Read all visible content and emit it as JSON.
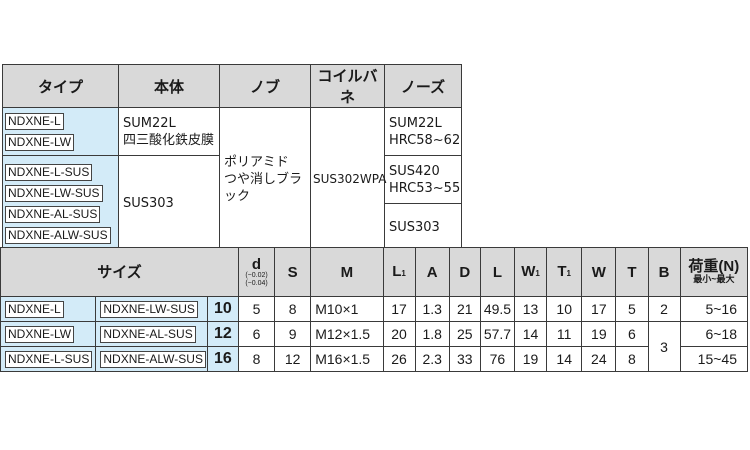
{
  "material_table": {
    "headers": [
      "タイプ",
      "本体",
      "ノブ",
      "コイルバネ",
      "ノーズ"
    ],
    "types": [
      "NDXNE-L",
      "NDXNE-LW",
      "NDXNE-L-SUS",
      "NDXNE-LW-SUS",
      "NDXNE-AL-SUS",
      "NDXNE-ALW-SUS"
    ],
    "body": [
      "SUM22L\n四三酸化鉄皮膜",
      "SUS303"
    ],
    "knob": "ポリアミド\nつや消しブラック",
    "spring": "SUS302WPA",
    "nose": [
      "SUM22L\nHRC58~62",
      "SUS420\nHRC53~55",
      "SUS303"
    ]
  },
  "dim_table": {
    "headers": {
      "size": "サイズ",
      "d": "d",
      "d_tol_upper": "(−0.02)",
      "d_tol_lower": "(−0.04)",
      "S": "S",
      "M": "M",
      "L1": "L",
      "L1_sub": "1",
      "A": "A",
      "D": "D",
      "L": "L",
      "W1": "W",
      "W1_sub": "1",
      "T1": "T",
      "T1_sub": "1",
      "W": "W",
      "T": "T",
      "B": "B",
      "load": "荷重(N)",
      "load_sub": "最小~最大"
    },
    "rows": [
      {
        "model_a": "NDXNE-L",
        "model_b": "NDXNE-LW-SUS",
        "size": "10",
        "d": "5",
        "S": "8",
        "M": "M10×1",
        "L1": "17",
        "A": "1.3",
        "D": "21",
        "L": "49.5",
        "W1": "13",
        "T1": "10",
        "W": "17",
        "T": "5",
        "B": "2",
        "load": "5~16"
      },
      {
        "model_a": "NDXNE-LW",
        "model_b": "NDXNE-AL-SUS",
        "size": "12",
        "d": "6",
        "S": "9",
        "M": "M12×1.5",
        "L1": "20",
        "A": "1.8",
        "D": "25",
        "L": "57.7",
        "W1": "14",
        "T1": "11",
        "W": "19",
        "T": "6",
        "B": "3",
        "load": "6~18"
      },
      {
        "model_a": "NDXNE-L-SUS",
        "model_b": "NDXNE-ALW-SUS",
        "size": "16",
        "d": "8",
        "S": "12",
        "M": "M16×1.5",
        "L1": "26",
        "A": "2.3",
        "D": "33",
        "L": "76",
        "W1": "19",
        "T1": "14",
        "W": "24",
        "T": "8",
        "load": "15~45"
      }
    ]
  }
}
